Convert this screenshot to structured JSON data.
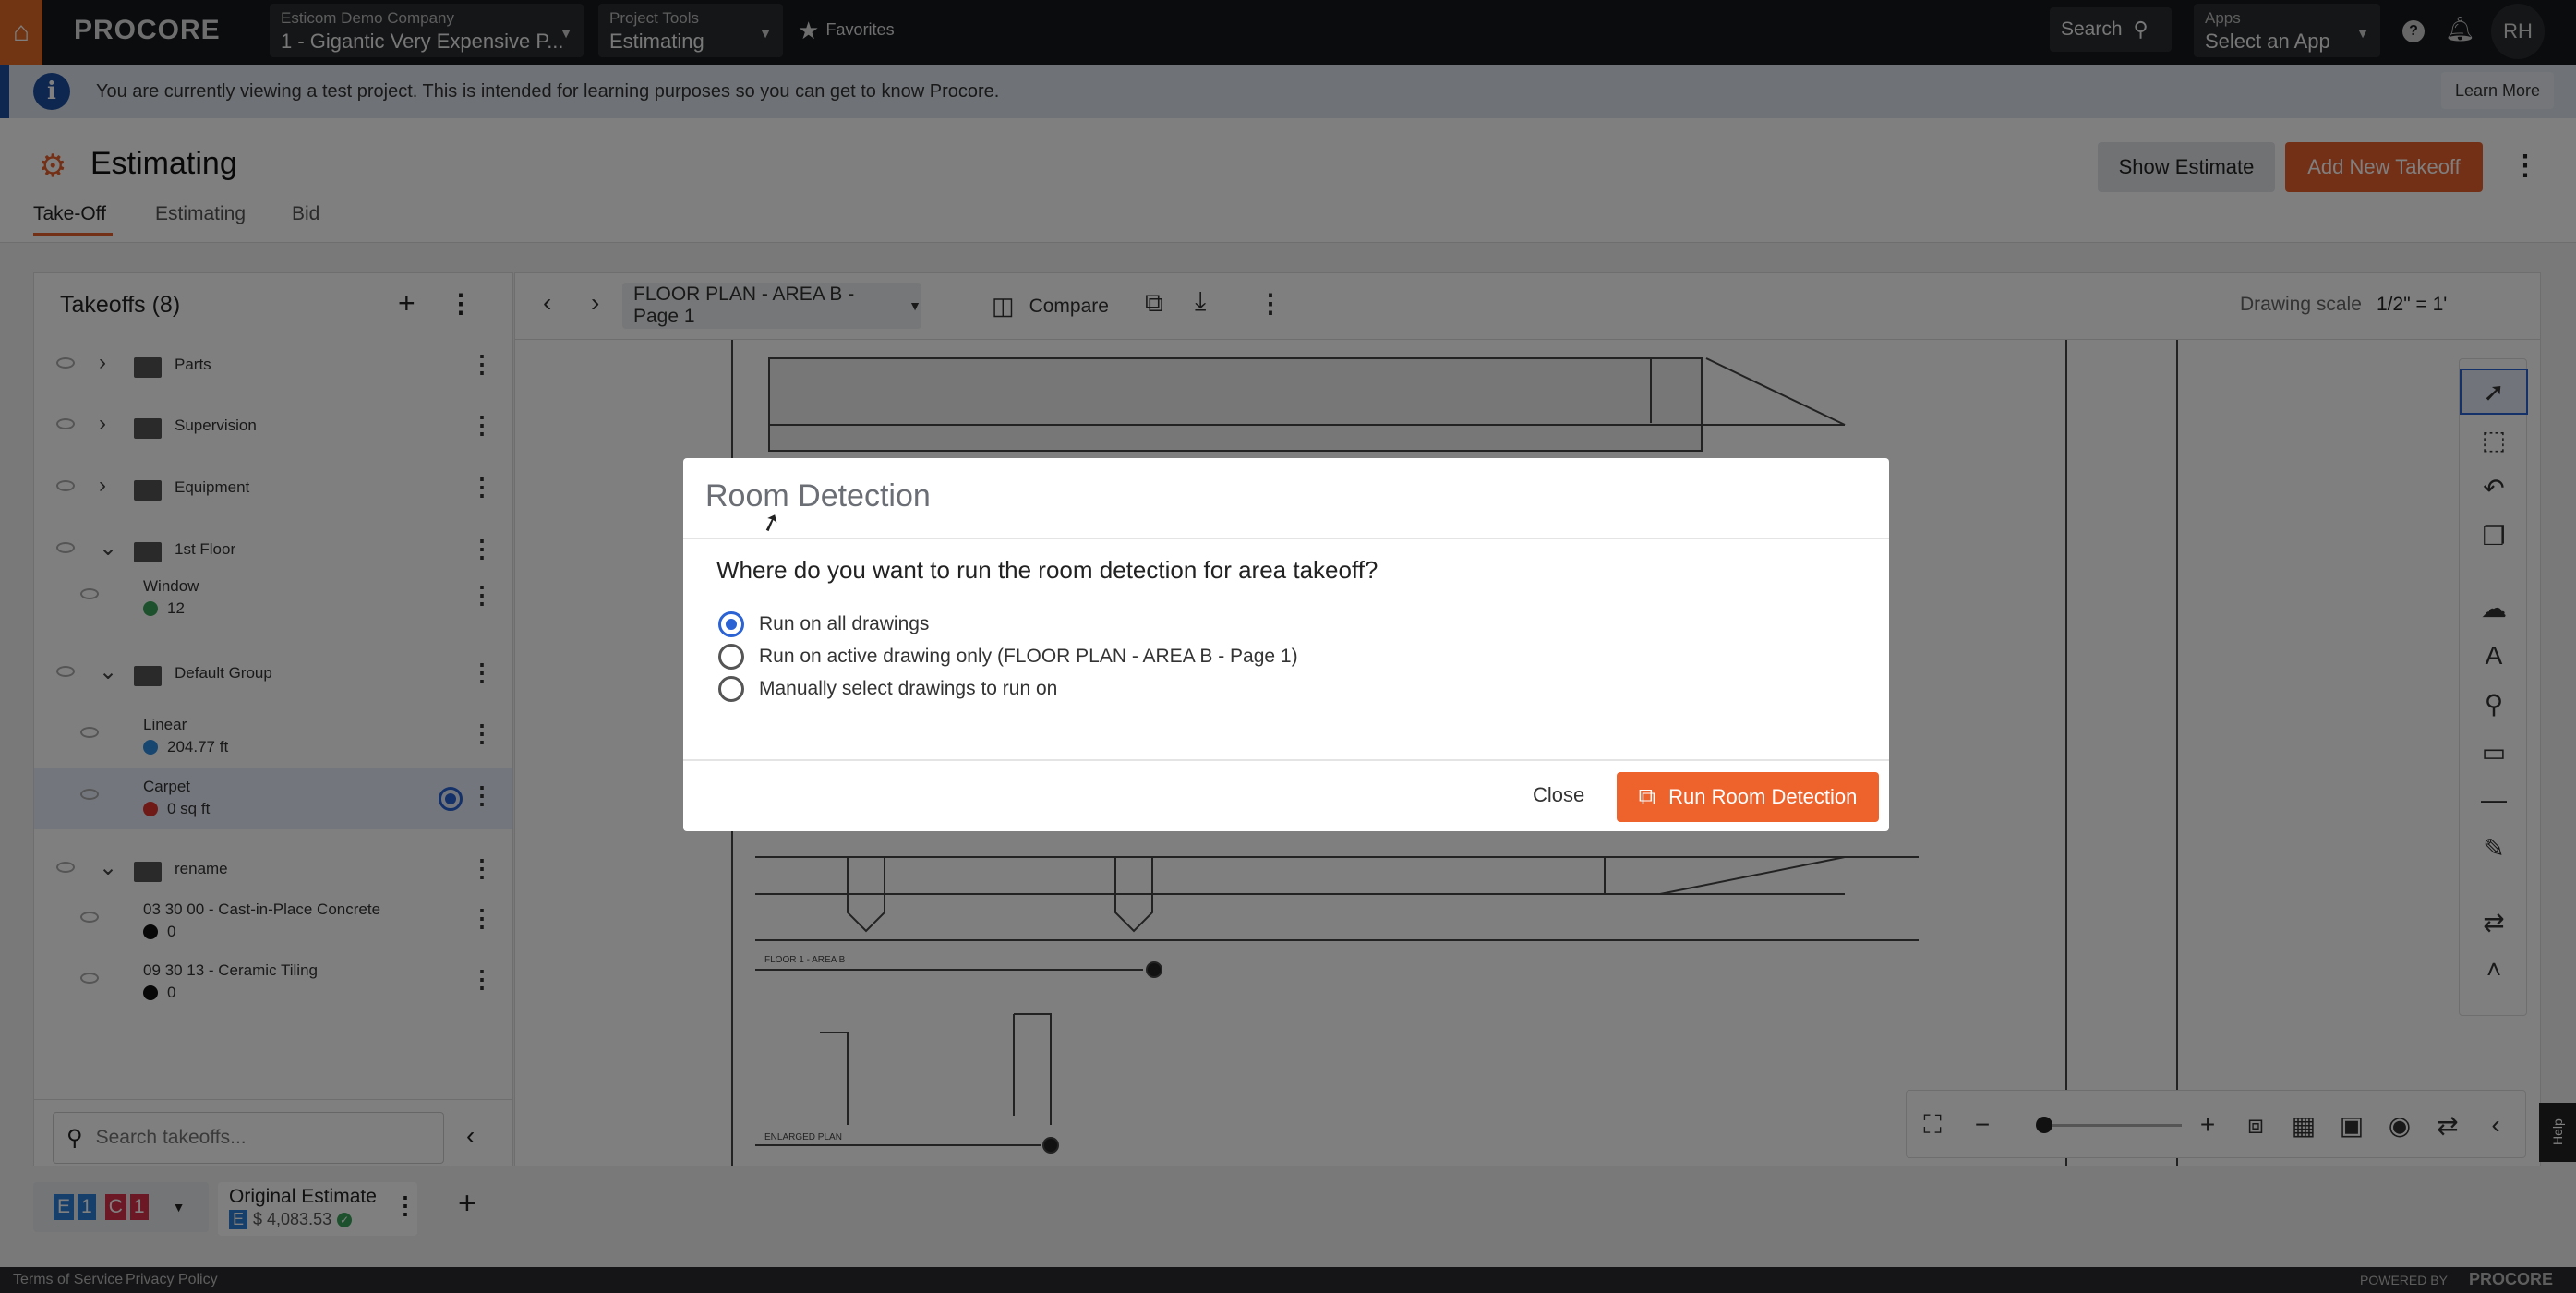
{
  "topbar": {
    "logo": "PROCORE",
    "company_label": "Esticom Demo Company",
    "company_value": "1 - Gigantic Very Expensive P...",
    "tools_label": "Project Tools",
    "tools_value": "Estimating",
    "favorites": "Favorites",
    "search": "Search",
    "apps_label": "Apps",
    "apps_value": "Select an App",
    "avatar": "RH"
  },
  "banner": {
    "text": "You are currently viewing a test project. This is intended for learning purposes so you can get to know Procore.",
    "learn_more": "Learn More"
  },
  "page": {
    "title": "Estimating",
    "show_estimate": "Show Estimate",
    "add_takeoff": "Add New Takeoff",
    "tabs": [
      {
        "label": "Take-Off",
        "active": true
      },
      {
        "label": "Estimating"
      },
      {
        "label": "Bid"
      }
    ]
  },
  "takeoffs": {
    "title": "Takeoffs (8)",
    "search_placeholder": "Search takeoffs...",
    "items": [
      {
        "name": "Parts",
        "type": "folder",
        "expanded": false
      },
      {
        "name": "Supervision",
        "type": "folder",
        "expanded": false
      },
      {
        "name": "Equipment",
        "type": "folder",
        "expanded": false
      },
      {
        "name": "1st Floor",
        "type": "folder",
        "expanded": true
      },
      {
        "name": "Window",
        "value": "12",
        "color": "#3aa35a",
        "type": "item"
      },
      {
        "name": "Default Group",
        "type": "folder",
        "expanded": true
      },
      {
        "name": "Linear",
        "value": "204.77 ft",
        "color": "#2f8ee0",
        "type": "item"
      },
      {
        "name": "Carpet",
        "value": "0 sq ft",
        "color": "#e0342f",
        "type": "item",
        "selected": true
      },
      {
        "name": "rename",
        "type": "folder",
        "expanded": true
      },
      {
        "name": "03 30 00 - Cast-in-Place Concrete",
        "value": "0",
        "color": "#111111",
        "type": "item"
      },
      {
        "name": "09 30 13 - Ceramic Tiling",
        "value": "0",
        "color": "#111111",
        "type": "item"
      }
    ]
  },
  "estimate_tabs": {
    "badges": [
      "E",
      "1",
      "C",
      "1"
    ],
    "name": "Original Estimate",
    "badge": "E",
    "amount": "$ 4,083.53"
  },
  "drawing": {
    "sheet": "FLOOR PLAN - AREA B - Page 1",
    "compare": "Compare",
    "scale_label": "Drawing scale",
    "scale_value": "1/2\" = 1'",
    "plan_label_1": "FLOOR 1 - AREA B",
    "plan_label_2": "ENLARGED PLAN",
    "help": "Help"
  },
  "modal": {
    "title": "Room Detection",
    "question": "Where do you want to run the room detection for area takeoff?",
    "options": [
      {
        "label": "Run on all drawings",
        "selected": true
      },
      {
        "label": "Run on active drawing only (FLOOR PLAN - AREA B - Page 1)",
        "selected": false
      },
      {
        "label": "Manually select drawings to run on",
        "selected": false
      }
    ],
    "close": "Close",
    "run": "Run Room Detection"
  },
  "footer": {
    "terms": "Terms of Service",
    "privacy": "Privacy Policy",
    "powered": "POWERED BY",
    "brand": "PROCORE"
  },
  "colors": {
    "accent": "#e8602c",
    "selected_radio": "#2b62d4",
    "banner_icon": "#1d4ea0"
  }
}
